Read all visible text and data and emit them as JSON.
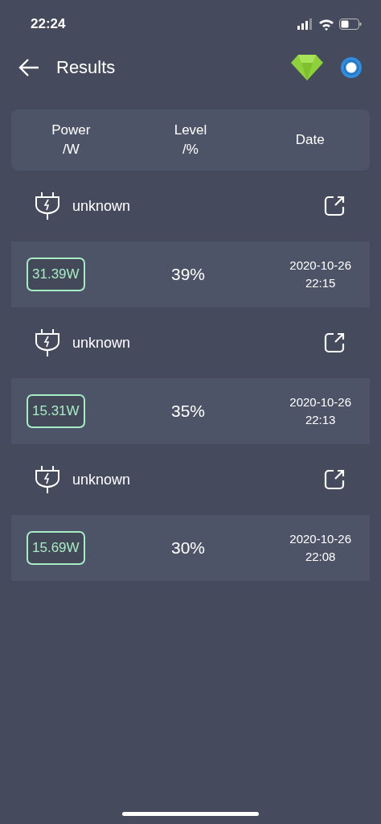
{
  "status_bar": {
    "time": "22:24"
  },
  "app_bar": {
    "title": "Results"
  },
  "table_header": {
    "columns": [
      [
        "Power",
        "/W"
      ],
      [
        "Level",
        "/%"
      ],
      [
        "Date"
      ]
    ]
  },
  "results": [
    {
      "device": "unknown",
      "power": "31.39W",
      "level": "39%",
      "date": "2020-10-26",
      "time": "22:15"
    },
    {
      "device": "unknown",
      "power": "15.31W",
      "level": "35%",
      "date": "2020-10-26",
      "time": "22:13"
    },
    {
      "device": "unknown",
      "power": "15.69W",
      "level": "30%",
      "date": "2020-10-26",
      "time": "22:08"
    }
  ]
}
